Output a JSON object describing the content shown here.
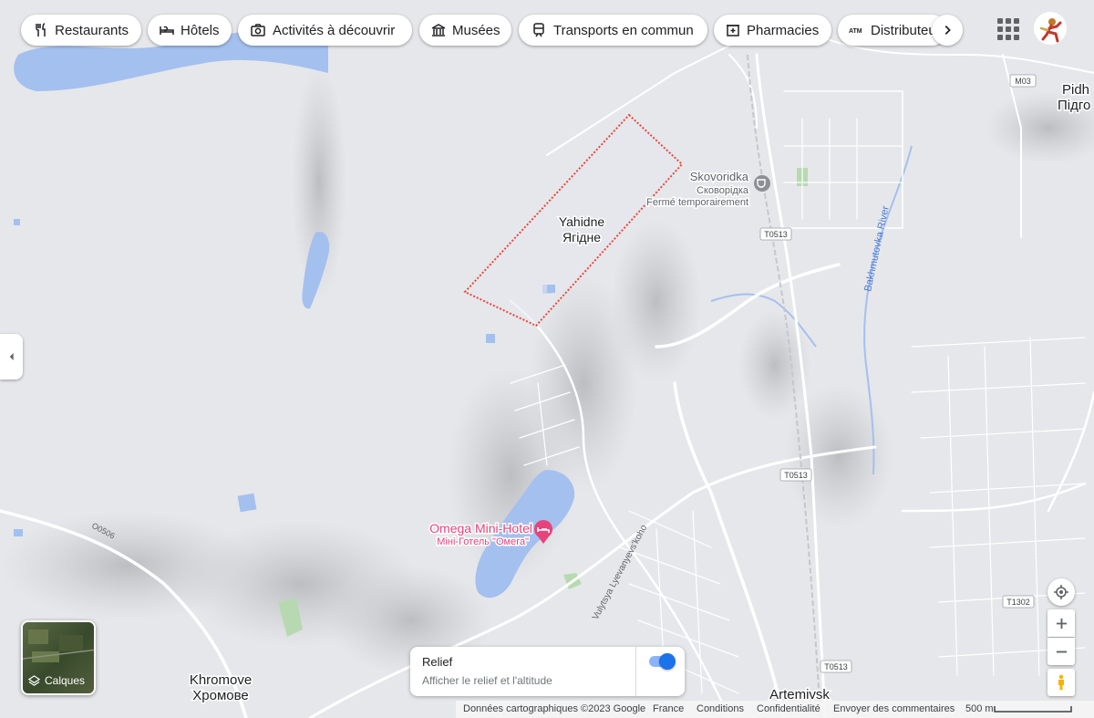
{
  "categories": [
    {
      "label": "Restaurants",
      "icon": "fork-knife-icon"
    },
    {
      "label": "Hôtels",
      "icon": "bed-icon"
    },
    {
      "label": "Activités à découvrir",
      "icon": "camera-icon"
    },
    {
      "label": "Musées",
      "icon": "museum-icon"
    },
    {
      "label": "Transports en commun",
      "icon": "train-icon"
    },
    {
      "label": "Pharmacies",
      "icon": "pharmacy-icon"
    },
    {
      "label": "Distributeurs",
      "icon": "atm-icon"
    }
  ],
  "map": {
    "places": {
      "yahidne_latin": "Yahidne",
      "yahidne_cyr": "Ягідне",
      "skovoridka_latin": "Skovoridka",
      "skovoridka_cyr": "Сковорідка",
      "skovoridka_status": "Fermé temporairement",
      "omega_latin": "Omega Mini-Hotel",
      "omega_cyr": "Міні-Готель \"Омега\"",
      "khromove_latin": "Khromove",
      "khromove_cyr": "Хромове",
      "artemivsk": "Artemivsk",
      "pidh_latin": "Pidh",
      "pidh_cyr": "Підго",
      "river": "Bakhmutovka River",
      "street": "Vulytsya Lyevanyevs'koho"
    },
    "road_shields": {
      "m03": "M03",
      "t0513_a": "T0513",
      "t0513_b": "T0513",
      "t0513_c": "T0513",
      "t1302": "T1302",
      "o0506": "O0506"
    }
  },
  "layers_button": {
    "label": "Calques"
  },
  "relief_panel": {
    "title": "Relief",
    "subtitle": "Afficher le relief et l'altitude",
    "enabled": true
  },
  "footer": {
    "data": "Données cartographiques ©2023 Google",
    "country": "France",
    "terms": "Conditions",
    "privacy": "Confidentialité",
    "feedback": "Envoyer des commentaires",
    "scale": "500 m"
  },
  "colors": {
    "water": "#a4c0ef",
    "road": "#ffffff",
    "highlight_border": "#e8473a",
    "poi_pink": "#e8437a",
    "park": "#a9d6a4",
    "toggle_on": "#1a73e8"
  }
}
